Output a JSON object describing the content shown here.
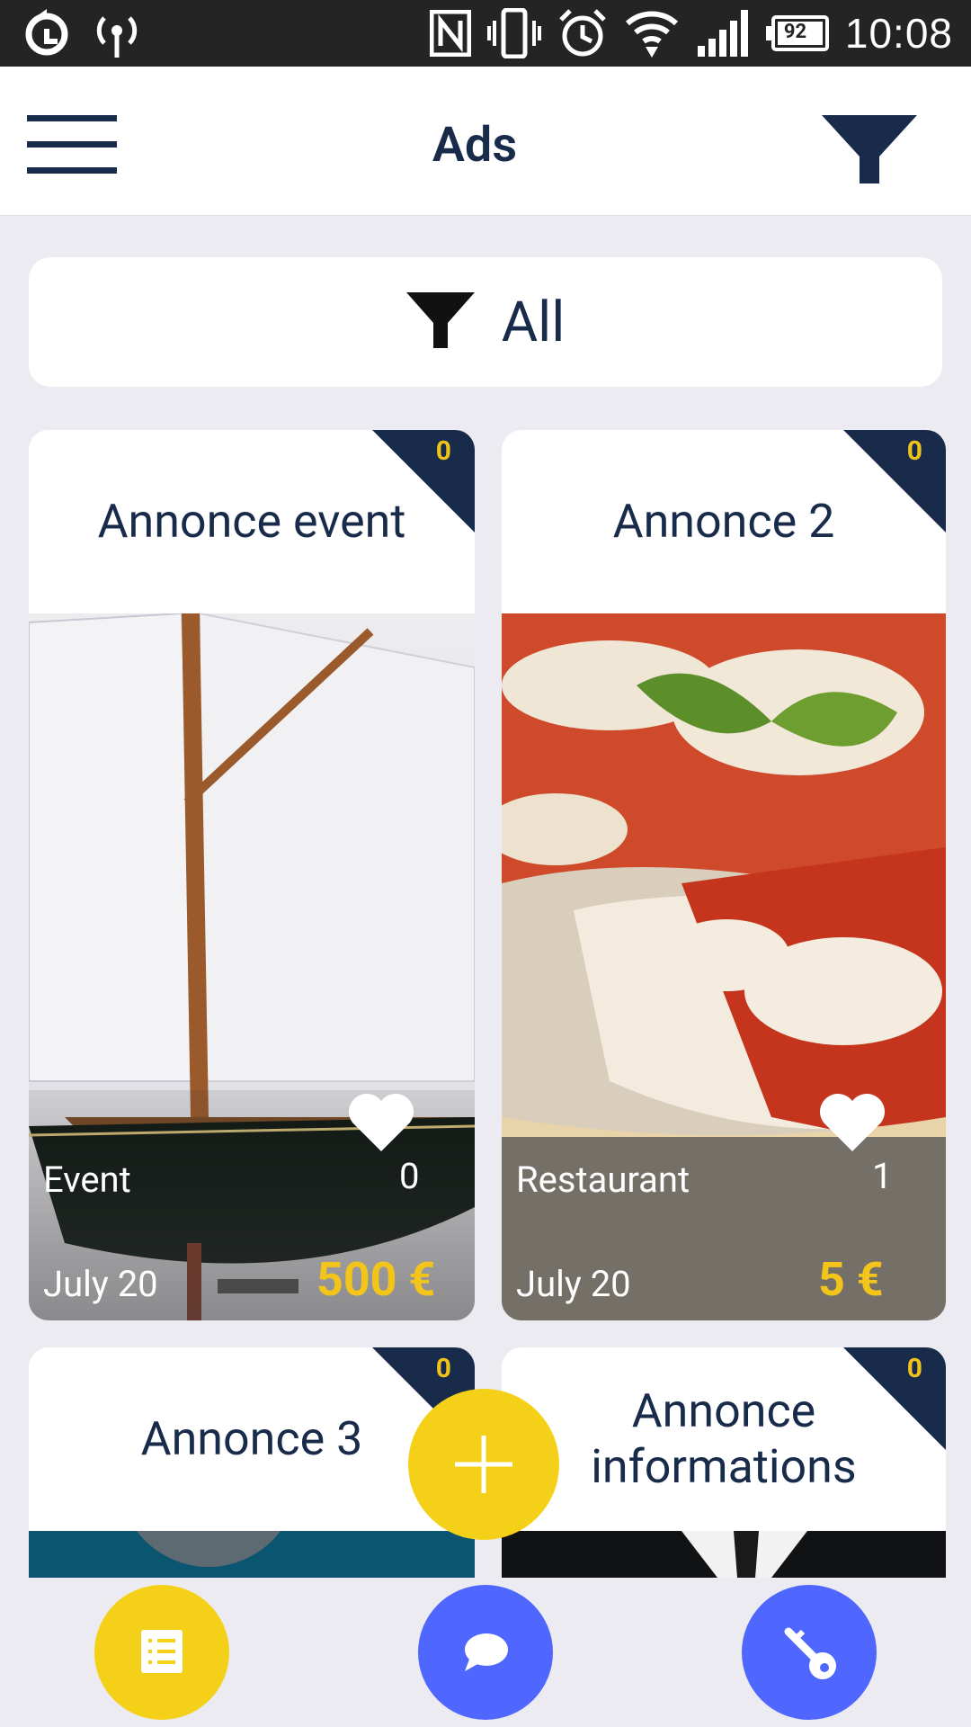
{
  "status_bar": {
    "time": "10:08",
    "battery": "92",
    "icons": [
      "sync-icon",
      "hotspot-icon",
      "nfc-icon",
      "vibrate-icon",
      "alarm-icon",
      "wifi-icon",
      "signal-icon",
      "battery-icon"
    ]
  },
  "app_bar": {
    "title": "Ads",
    "menu_icon": "hamburger-menu-icon",
    "filter_icon": "filter-funnel-icon"
  },
  "filter_bar": {
    "label": "All",
    "icon": "filter-funnel-icon"
  },
  "cards": [
    {
      "title": "Annonce event",
      "badge_count": "0",
      "category": "Event",
      "likes": "0",
      "date": "July  20",
      "price": "500 €",
      "image": "sailboat-model"
    },
    {
      "title": "Annonce 2",
      "badge_count": "0",
      "category": "Restaurant",
      "likes": "1",
      "date": "July  20",
      "price": "5 €",
      "image": "pizza"
    },
    {
      "title": "Annonce 3",
      "badge_count": "0",
      "image": "teal-image"
    },
    {
      "title": "Annonce informations",
      "badge_count": "0",
      "image": "suit-image"
    }
  ],
  "fab": {
    "icon": "plus-icon"
  },
  "bottom_nav": [
    {
      "icon": "list-icon",
      "color": "#f5d018"
    },
    {
      "icon": "chat-bubble-icon",
      "color": "#4f66ff"
    },
    {
      "icon": "key-icon",
      "color": "#4f66ff"
    }
  ],
  "colors": {
    "navy": "#192b4a",
    "yellow": "#f5d018",
    "blue": "#4f66ff",
    "background": "#ebebf1"
  }
}
